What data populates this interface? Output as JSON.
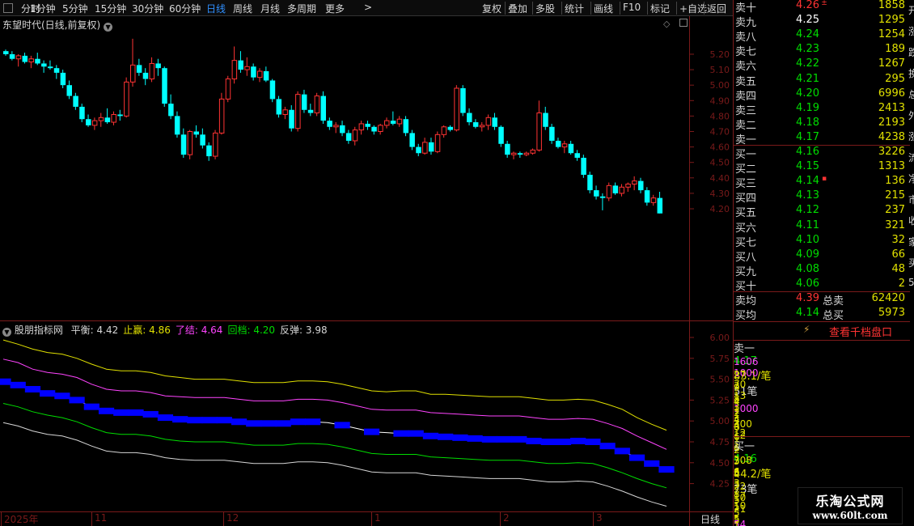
{
  "toolbar": {
    "periods": [
      "分时",
      "1分钟",
      "5分钟",
      "15分钟",
      "30分钟",
      "60分钟",
      "日线",
      "周线",
      "月线",
      "多周期",
      "更多"
    ],
    "active_period": "日线",
    "more_arrow": ">",
    "right_buttons": [
      "复权",
      "叠加",
      "多股",
      "统计",
      "画线",
      "F10",
      "标记",
      "+自选",
      "返回"
    ]
  },
  "main_chart": {
    "title": "东望时代(日线,前复权)",
    "price_axis": [
      "5.20",
      "5.10",
      "5.00",
      "4.90",
      "4.80",
      "4.70",
      "4.60",
      "4.50",
      "4.40",
      "4.30",
      "4.20"
    ]
  },
  "indicator": {
    "name": "股朋指标网",
    "fields": [
      {
        "label": "平衡:",
        "value": "4.42",
        "color": "#d6d6d6"
      },
      {
        "label": "止赢:",
        "value": "4.86",
        "color": "#e0e000"
      },
      {
        "label": "了结:",
        "value": "4.64",
        "color": "#ff44ff"
      },
      {
        "label": "回档:",
        "value": "4.20",
        "color": "#00dd00"
      },
      {
        "label": "反弹:",
        "value": "3.98",
        "color": "#d6d6d6"
      }
    ],
    "axis": [
      "6.00",
      "5.75",
      "5.50",
      "5.25",
      "5.00",
      "4.75",
      "4.50",
      "4.25"
    ]
  },
  "date_axis": {
    "labels": [
      "2025年",
      "11",
      "12",
      "1",
      "2",
      "3"
    ],
    "period_label": "日线"
  },
  "orderbook": {
    "asks": [
      {
        "label": "卖十",
        "price": "4.26",
        "mark": "±",
        "volume": "1858",
        "color": "red"
      },
      {
        "label": "卖九",
        "price": "4.25",
        "mark": "",
        "volume": "1295",
        "color": "white"
      },
      {
        "label": "卖八",
        "price": "4.24",
        "mark": "",
        "volume": "1254",
        "color": "green"
      },
      {
        "label": "卖七",
        "price": "4.23",
        "mark": "",
        "volume": "189",
        "color": "green"
      },
      {
        "label": "卖六",
        "price": "4.22",
        "mark": "",
        "volume": "1267",
        "color": "green"
      },
      {
        "label": "卖五",
        "price": "4.21",
        "mark": "",
        "volume": "295",
        "color": "green"
      },
      {
        "label": "卖四",
        "price": "4.20",
        "mark": "",
        "volume": "6996",
        "color": "green"
      },
      {
        "label": "卖三",
        "price": "4.19",
        "mark": "",
        "volume": "2413",
        "color": "green"
      },
      {
        "label": "卖二",
        "price": "4.18",
        "mark": "",
        "volume": "2193",
        "color": "green"
      },
      {
        "label": "卖一",
        "price": "4.17",
        "mark": "",
        "volume": "4238",
        "color": "green"
      }
    ],
    "bids": [
      {
        "label": "买一",
        "price": "4.16",
        "mark": "",
        "volume": "3226",
        "color": "green"
      },
      {
        "label": "买二",
        "price": "4.15",
        "mark": "",
        "volume": "1313",
        "color": "green"
      },
      {
        "label": "买三",
        "price": "4.14",
        "mark": "▪",
        "volume": "136",
        "color": "green"
      },
      {
        "label": "买四",
        "price": "4.13",
        "mark": "",
        "volume": "215",
        "color": "green"
      },
      {
        "label": "买五",
        "price": "4.12",
        "mark": "",
        "volume": "237",
        "color": "green"
      },
      {
        "label": "买六",
        "price": "4.11",
        "mark": "",
        "volume": "321",
        "color": "green"
      },
      {
        "label": "买七",
        "price": "4.10",
        "mark": "",
        "volume": "32",
        "color": "green"
      },
      {
        "label": "买八",
        "price": "4.09",
        "mark": "",
        "volume": "66",
        "color": "green"
      },
      {
        "label": "买九",
        "price": "4.08",
        "mark": "",
        "volume": "48",
        "color": "green"
      },
      {
        "label": "买十",
        "price": "4.06",
        "mark": "",
        "volume": "2",
        "color": "green"
      }
    ],
    "avg_sell": {
      "label": "卖均",
      "price": "4.39",
      "total_label": "总卖",
      "total": "62420"
    },
    "avg_buy": {
      "label": "买均",
      "price": "4.14",
      "total_label": "总买",
      "total": "5973"
    },
    "thousand_button": "查看千档盘口"
  },
  "queue": {
    "sell_head": {
      "label": "卖一",
      "price": "4.17",
      "avg": "83.1/笔",
      "count": "51笔"
    },
    "sell_rows": [
      [
        "1606",
        "1000",
        "70",
        "13",
        "3"
      ],
      [
        "27",
        "3",
        "1",
        "1000",
        "4"
      ],
      [
        "9",
        "8",
        "1",
        "2",
        "12"
      ],
      [
        "4",
        "2",
        "300",
        "12",
        "1"
      ],
      [
        "1",
        "4",
        "6",
        "6",
        "7"
      ],
      [
        "6",
        "1",
        "2",
        "5",
        "5"
      ]
    ],
    "buy_head": {
      "label": "买一",
      "price": "4.16",
      "avg": "44.2/笔",
      "count": "73笔"
    },
    "buy_rows": [
      [
        "308",
        "6",
        "3",
        "8",
        "10"
      ],
      [
        "5",
        "3",
        "17",
        "1",
        "5"
      ],
      [
        "22",
        "10",
        "21",
        "5",
        "5"
      ],
      [
        "5",
        "",
        "",
        "",
        ""
      ],
      [
        "5",
        "54",
        "",
        "",
        ""
      ],
      [
        "1",
        "",
        "",
        "",
        ""
      ]
    ]
  },
  "side_strip": [
    "开",
    "涨",
    "跌",
    "换",
    "总",
    "外",
    "涨",
    "流",
    "净",
    "市",
    "收",
    "家",
    "买",
    "5"
  ],
  "logo": {
    "line1": "乐淘公式网",
    "line2": "www.60lt.com"
  },
  "colors": {
    "up": "#ff3333",
    "down": "#00ffff",
    "ma_blue": "#0000ff",
    "green": "#00dd00",
    "yellow": "#e0e000",
    "magenta": "#ff44ff",
    "grid_red": "#7a1a1a",
    "active_blue": "#2f8fff"
  },
  "candles": [
    [
      5.22,
      5.23,
      5.19,
      5.2
    ],
    [
      5.2,
      5.22,
      5.16,
      5.17
    ],
    [
      5.17,
      5.2,
      5.12,
      5.19
    ],
    [
      5.19,
      5.21,
      5.14,
      5.15
    ],
    [
      5.15,
      5.19,
      5.11,
      5.17
    ],
    [
      5.17,
      5.21,
      5.13,
      5.14
    ],
    [
      5.14,
      5.16,
      5.08,
      5.12
    ],
    [
      5.12,
      5.16,
      5.1,
      5.11
    ],
    [
      5.11,
      5.13,
      5.04,
      5.08
    ],
    [
      5.08,
      5.1,
      4.98,
      5.0
    ],
    [
      5.0,
      5.03,
      4.91,
      4.93
    ],
    [
      4.93,
      4.95,
      4.84,
      4.86
    ],
    [
      4.86,
      4.88,
      4.76,
      4.78
    ],
    [
      4.78,
      4.81,
      4.73,
      4.74
    ],
    [
      4.74,
      4.79,
      4.71,
      4.77
    ],
    [
      4.77,
      4.82,
      4.73,
      4.79
    ],
    [
      4.79,
      4.85,
      4.75,
      4.76
    ],
    [
      4.76,
      4.83,
      4.74,
      4.81
    ],
    [
      4.81,
      4.84,
      4.77,
      4.8
    ],
    [
      4.8,
      5.05,
      4.79,
      5.02
    ],
    [
      5.02,
      5.3,
      4.99,
      5.13
    ],
    [
      5.13,
      5.17,
      5.06,
      5.08
    ],
    [
      5.08,
      5.11,
      5.0,
      5.04
    ],
    [
      5.04,
      5.18,
      5.02,
      5.14
    ],
    [
      5.14,
      5.17,
      5.06,
      5.11
    ],
    [
      5.11,
      5.12,
      4.86,
      4.88
    ],
    [
      4.88,
      4.94,
      4.78,
      4.8
    ],
    [
      4.8,
      4.83,
      4.66,
      4.68
    ],
    [
      4.68,
      4.72,
      4.53,
      4.55
    ],
    [
      4.55,
      4.71,
      4.52,
      4.7
    ],
    [
      4.7,
      4.74,
      4.66,
      4.68
    ],
    [
      4.68,
      4.72,
      4.59,
      4.61
    ],
    [
      4.61,
      4.63,
      4.51,
      4.54
    ],
    [
      4.54,
      4.71,
      4.52,
      4.69
    ],
    [
      4.69,
      4.95,
      4.68,
      4.91
    ],
    [
      4.91,
      5.06,
      4.89,
      5.04
    ],
    [
      5.04,
      5.25,
      5.01,
      5.16
    ],
    [
      5.16,
      5.22,
      5.08,
      5.1
    ],
    [
      5.1,
      5.18,
      5.06,
      5.12
    ],
    [
      5.12,
      5.14,
      5.03,
      5.05
    ],
    [
      5.05,
      5.11,
      5.02,
      5.09
    ],
    [
      5.09,
      5.12,
      5.02,
      5.03
    ],
    [
      5.03,
      5.04,
      4.89,
      4.91
    ],
    [
      4.91,
      4.93,
      4.79,
      4.81
    ],
    [
      4.81,
      4.86,
      4.78,
      4.84
    ],
    [
      4.84,
      4.87,
      4.7,
      4.72
    ],
    [
      4.72,
      4.96,
      4.7,
      4.94
    ],
    [
      4.94,
      4.97,
      4.82,
      4.84
    ],
    [
      4.84,
      4.88,
      4.8,
      4.82
    ],
    [
      4.82,
      4.95,
      4.8,
      4.93
    ],
    [
      4.93,
      4.96,
      4.75,
      4.77
    ],
    [
      4.77,
      4.79,
      4.71,
      4.73
    ],
    [
      4.73,
      4.76,
      4.69,
      4.74
    ],
    [
      4.74,
      4.77,
      4.67,
      4.69
    ],
    [
      4.69,
      4.71,
      4.62,
      4.64
    ],
    [
      4.64,
      4.73,
      4.61,
      4.71
    ],
    [
      4.71,
      4.77,
      4.68,
      4.75
    ],
    [
      4.75,
      4.77,
      4.71,
      4.73
    ],
    [
      4.73,
      4.74,
      4.68,
      4.7
    ],
    [
      4.7,
      4.75,
      4.68,
      4.74
    ],
    [
      4.74,
      4.79,
      4.72,
      4.77
    ],
    [
      4.77,
      4.83,
      4.74,
      4.75
    ],
    [
      4.75,
      4.8,
      4.73,
      4.78
    ],
    [
      4.78,
      4.8,
      4.67,
      4.69
    ],
    [
      4.69,
      4.71,
      4.58,
      4.6
    ],
    [
      4.6,
      4.62,
      4.54,
      4.56
    ],
    [
      4.56,
      4.66,
      4.55,
      4.63
    ],
    [
      4.63,
      4.66,
      4.55,
      4.57
    ],
    [
      4.57,
      4.7,
      4.56,
      4.68
    ],
    [
      4.68,
      4.74,
      4.66,
      4.73
    ],
    [
      4.73,
      4.74,
      4.7,
      4.71
    ],
    [
      4.71,
      5.0,
      4.7,
      4.98
    ],
    [
      4.98,
      5.0,
      4.8,
      4.82
    ],
    [
      4.82,
      4.85,
      4.74,
      4.76
    ],
    [
      4.76,
      4.78,
      4.72,
      4.73
    ],
    [
      4.73,
      4.76,
      4.7,
      4.74
    ],
    [
      4.74,
      4.81,
      4.71,
      4.79
    ],
    [
      4.79,
      4.82,
      4.71,
      4.73
    ],
    [
      4.73,
      4.74,
      4.6,
      4.62
    ],
    [
      4.62,
      4.64,
      4.53,
      4.55
    ],
    [
      4.55,
      4.57,
      4.52,
      4.56
    ],
    [
      4.56,
      4.57,
      4.53,
      4.55
    ],
    [
      4.55,
      4.57,
      4.54,
      4.56
    ],
    [
      4.56,
      4.59,
      4.55,
      4.58
    ],
    [
      4.58,
      4.9,
      4.57,
      4.82
    ],
    [
      4.82,
      4.86,
      4.71,
      4.73
    ],
    [
      4.73,
      4.75,
      4.62,
      4.64
    ],
    [
      4.64,
      4.66,
      4.59,
      4.6
    ],
    [
      4.6,
      4.64,
      4.56,
      4.62
    ],
    [
      4.62,
      4.64,
      4.55,
      4.56
    ],
    [
      4.56,
      4.58,
      4.51,
      4.53
    ],
    [
      4.53,
      4.55,
      4.4,
      4.42
    ],
    [
      4.42,
      4.44,
      4.3,
      4.32
    ],
    [
      4.32,
      4.35,
      4.26,
      4.28
    ],
    [
      4.28,
      4.3,
      4.19,
      4.27
    ],
    [
      4.27,
      4.37,
      4.25,
      4.35
    ],
    [
      4.35,
      4.37,
      4.29,
      4.3
    ],
    [
      4.3,
      4.36,
      4.28,
      4.34
    ],
    [
      4.34,
      4.37,
      4.31,
      4.36
    ],
    [
      4.36,
      4.41,
      4.32,
      4.38
    ],
    [
      4.38,
      4.4,
      4.3,
      4.32
    ],
    [
      4.32,
      4.34,
      4.22,
      4.24
    ],
    [
      4.24,
      4.29,
      4.22,
      4.27
    ],
    [
      4.27,
      4.31,
      4.17,
      4.17
    ]
  ],
  "ind_series": {
    "yellow": [
      5.97,
      5.92,
      5.86,
      5.82,
      5.8,
      5.75,
      5.68,
      5.62,
      5.6,
      5.6,
      5.58,
      5.54,
      5.52,
      5.5,
      5.5,
      5.5,
      5.48,
      5.46,
      5.46,
      5.46,
      5.48,
      5.48,
      5.47,
      5.44,
      5.4,
      5.36,
      5.35,
      5.36,
      5.36,
      5.32,
      5.32,
      5.31,
      5.3,
      5.29,
      5.29,
      5.29,
      5.27,
      5.25,
      5.25,
      5.26,
      5.25,
      5.2,
      5.14,
      5.04,
      4.96,
      4.89
    ],
    "magenta": [
      5.74,
      5.7,
      5.62,
      5.58,
      5.56,
      5.52,
      5.44,
      5.38,
      5.36,
      5.36,
      5.34,
      5.3,
      5.29,
      5.28,
      5.28,
      5.28,
      5.26,
      5.24,
      5.24,
      5.24,
      5.26,
      5.26,
      5.25,
      5.22,
      5.18,
      5.14,
      5.13,
      5.13,
      5.13,
      5.1,
      5.09,
      5.08,
      5.07,
      5.06,
      5.06,
      5.06,
      5.04,
      5.02,
      5.02,
      5.03,
      5.02,
      4.97,
      4.91,
      4.82,
      4.74,
      4.66
    ],
    "blue": [
      5.47,
      5.43,
      5.38,
      5.33,
      5.3,
      5.25,
      5.17,
      5.12,
      5.1,
      5.1,
      5.08,
      5.04,
      5.02,
      5.01,
      5.01,
      5.01,
      4.99,
      4.97,
      4.97,
      4.97,
      4.99,
      4.99,
      4.98,
      4.95,
      4.91,
      4.87,
      4.86,
      4.85,
      4.85,
      4.82,
      4.81,
      4.8,
      4.79,
      4.78,
      4.78,
      4.78,
      4.76,
      4.75,
      4.75,
      4.76,
      4.75,
      4.7,
      4.64,
      4.56,
      4.49,
      4.42
    ],
    "green": [
      5.21,
      5.17,
      5.11,
      5.07,
      5.04,
      4.99,
      4.92,
      4.86,
      4.84,
      4.84,
      4.82,
      4.78,
      4.76,
      4.75,
      4.75,
      4.75,
      4.73,
      4.71,
      4.71,
      4.71,
      4.73,
      4.73,
      4.72,
      4.69,
      4.65,
      4.61,
      4.6,
      4.6,
      4.6,
      4.57,
      4.56,
      4.55,
      4.54,
      4.53,
      4.53,
      4.53,
      4.51,
      4.49,
      4.49,
      4.5,
      4.49,
      4.44,
      4.38,
      4.31,
      4.25,
      4.2
    ],
    "white": [
      4.98,
      4.94,
      4.88,
      4.84,
      4.82,
      4.77,
      4.7,
      4.64,
      4.62,
      4.62,
      4.6,
      4.56,
      4.54,
      4.53,
      4.53,
      4.53,
      4.51,
      4.49,
      4.49,
      4.49,
      4.51,
      4.51,
      4.5,
      4.47,
      4.43,
      4.39,
      4.38,
      4.38,
      4.38,
      4.35,
      4.34,
      4.33,
      4.32,
      4.31,
      4.31,
      4.31,
      4.29,
      4.27,
      4.27,
      4.28,
      4.27,
      4.22,
      4.16,
      4.09,
      4.03,
      3.98
    ]
  }
}
